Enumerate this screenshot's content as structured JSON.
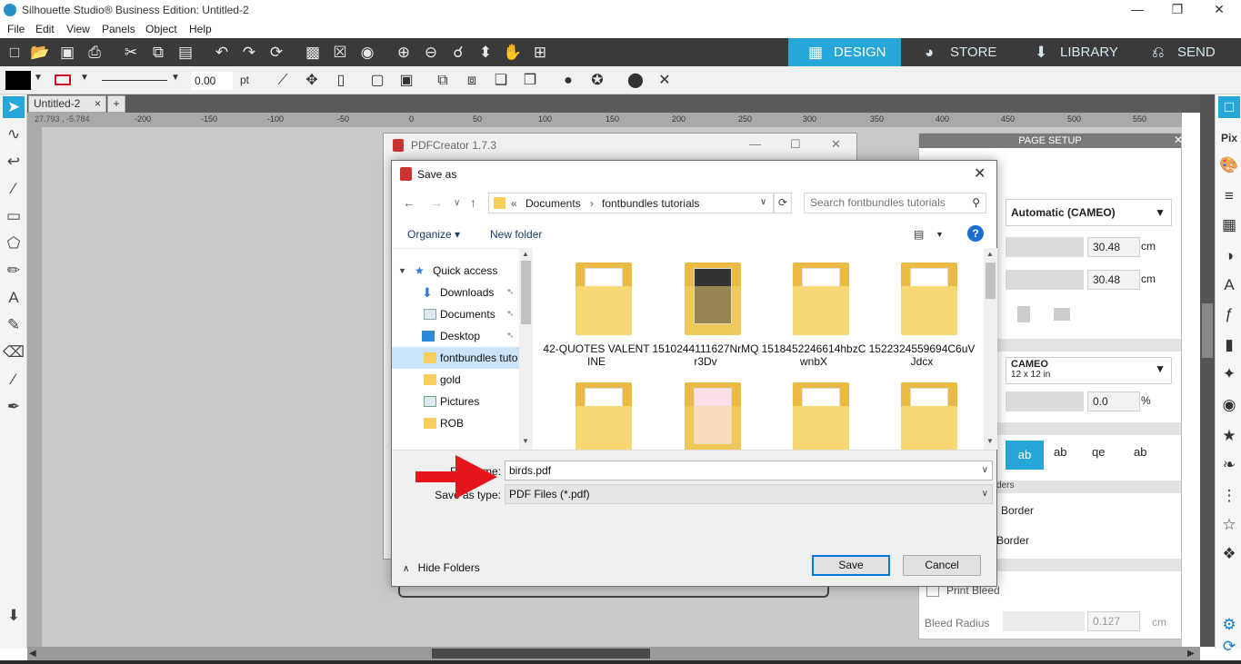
{
  "app": {
    "title": "Silhouette Studio® Business Edition: Untitled-2"
  },
  "menu": [
    "File",
    "Edit",
    "View",
    "Panels",
    "Object",
    "Help"
  ],
  "main_tabs": [
    {
      "label": "DESIGN",
      "icon": "grid-icon"
    },
    {
      "label": "STORE",
      "icon": "store-icon"
    },
    {
      "label": "LIBRARY",
      "icon": "library-icon"
    },
    {
      "label": "SEND",
      "icon": "send-icon"
    }
  ],
  "toolbar2": {
    "line_width": "0.00",
    "unit": "pt"
  },
  "doc_tab": {
    "label": "Untitled-2",
    "close": "×",
    "add": "+"
  },
  "coords": "27.793 , -5.784",
  "ruler": [
    "-200",
    "-150",
    "-100",
    "-50",
    "0",
    "50",
    "100",
    "150",
    "200",
    "250",
    "300",
    "350",
    "400",
    "450",
    "500",
    "550"
  ],
  "page_setup": {
    "title": "PAGE SETUP",
    "machine": "Automatic (CAMEO)",
    "width": "30.48",
    "height": "30.48",
    "unit_cm": "cm",
    "mat": "CAMEO",
    "mat_sub": "12 x 12 in",
    "scale": "0.0",
    "pct": "%",
    "ders": "ders",
    "border1": "Border",
    "border2": "Border",
    "print_bleed": "Print Bleed",
    "bleed_radius_label": "Bleed Radius",
    "bleed_radius": "0.127"
  },
  "pdfcreator": {
    "title": "PDFCreator 1.7.3"
  },
  "save_as": {
    "title": "Save as",
    "breadcrumb": [
      "«",
      "Documents",
      "›",
      "fontbundles tutorials"
    ],
    "search_placeholder": "Search fontbundles tutorials",
    "organize": "Organize ▾",
    "new_folder": "New folder",
    "help": "?",
    "nav_items": [
      {
        "label": "Quick access"
      },
      {
        "label": "Downloads"
      },
      {
        "label": "Documents"
      },
      {
        "label": "Desktop"
      },
      {
        "label": "fontbundles tuto"
      },
      {
        "label": "gold"
      },
      {
        "label": "Pictures"
      },
      {
        "label": "ROB"
      }
    ],
    "files": [
      {
        "name": "42-QUOTES VALENTINE"
      },
      {
        "name": "1510244111627NrMQr3Dv"
      },
      {
        "name": "1518452246614hbzCwnbX"
      },
      {
        "name": "1522324559694C6uVJdcx"
      },
      {
        "name": ""
      },
      {
        "name": ""
      },
      {
        "name": ""
      },
      {
        "name": ""
      }
    ],
    "file_name_label": "File name:",
    "file_name": "birds.pdf",
    "save_type_label": "Save as type:",
    "save_type": "PDF Files (*.pdf)",
    "hide_folders": "Hide Folders",
    "save_button": "Save",
    "cancel_button": "Cancel"
  },
  "colors": {
    "accent": "#25a7d7",
    "dark": "#3a3a3a",
    "arrow": "#e8141b"
  }
}
